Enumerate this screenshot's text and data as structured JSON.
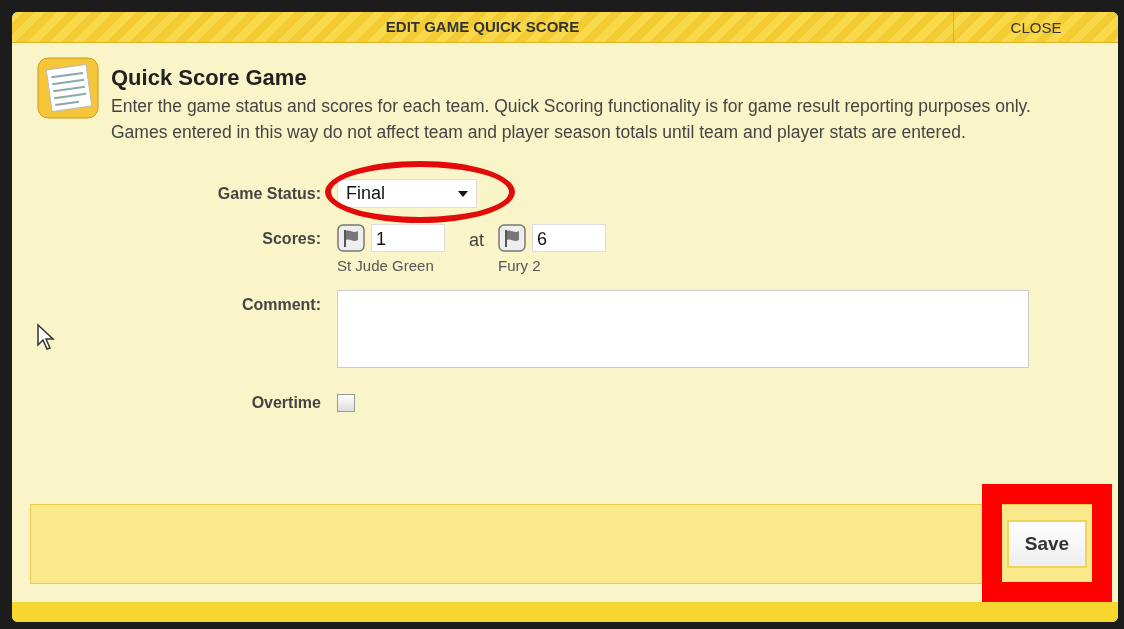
{
  "dialog": {
    "title": "EDIT GAME QUICK SCORE",
    "close_label": "CLOSE"
  },
  "header": {
    "heading": "Quick Score Game",
    "description": "Enter the game status and scores for each team. Quick Scoring functionality is for game result reporting purposes only. Games entered in this way do not affect team and player season totals until team and player stats are entered."
  },
  "form": {
    "status_label": "Game Status:",
    "status_value": "Final",
    "scores_label": "Scores:",
    "separator": "at",
    "teams": [
      {
        "score": "1",
        "name": "St Jude Green"
      },
      {
        "score": "6",
        "name": "Fury 2"
      }
    ],
    "comment_label": "Comment:",
    "overtime_label": "Overtime",
    "overtime_checked": false
  },
  "footer": {
    "save_label": "Save"
  },
  "highlights": {
    "status_field": true,
    "save_button": true
  }
}
